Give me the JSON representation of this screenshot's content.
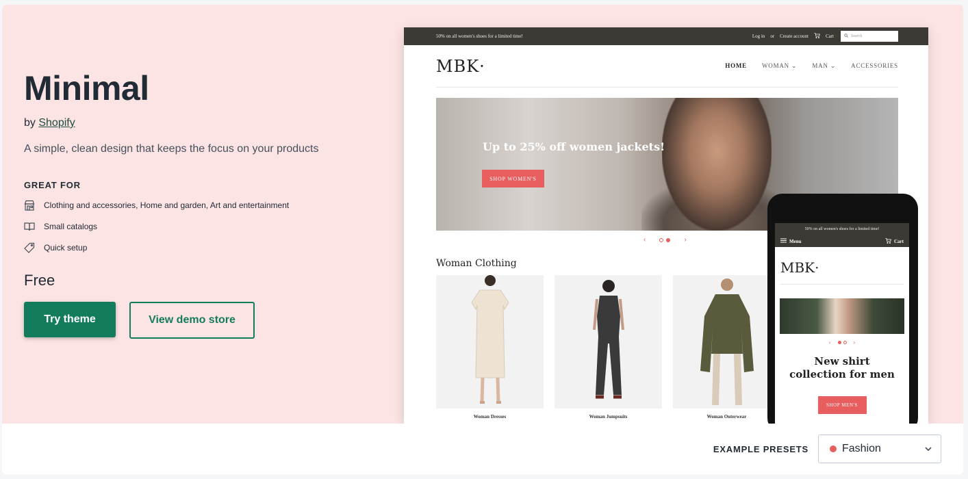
{
  "theme": {
    "title": "Minimal",
    "by_prefix": "by",
    "author": "Shopify",
    "description": "A simple, clean design that keeps the focus on your products",
    "great_for_heading": "GREAT FOR",
    "features": [
      {
        "icon": "store-icon",
        "label": "Clothing and accessories, Home and garden, Art and entertainment"
      },
      {
        "icon": "book-icon",
        "label": "Small catalogs"
      },
      {
        "icon": "tag-icon",
        "label": "Quick setup"
      }
    ],
    "price": "Free",
    "try_label": "Try theme",
    "demo_label": "View demo store"
  },
  "desktop_preview": {
    "announcement": "50% on all women's shoes for a limited time!",
    "login": "Log in",
    "or": "or",
    "create_account": "Create account",
    "cart": "Cart",
    "search_placeholder": "Search",
    "logo": "MBK·",
    "nav": [
      "HOME",
      "WOMAN ⌄",
      "MAN ⌄",
      "ACCESSORIES"
    ],
    "banner_text": "Up to 25% off women jackets!",
    "banner_button": "SHOP WOMEN'S",
    "section_title": "Woman Clothing",
    "products": [
      "Woman Dresses",
      "Woman Jumpsuits",
      "Woman Outerwear"
    ]
  },
  "mobile_preview": {
    "announcement": "50% on all women's shoes for a limited time!",
    "menu": "Menu",
    "cart": "Cart",
    "logo": "MBK·",
    "headline": "New shirt collection for men",
    "button": "SHOP MEN'S"
  },
  "footer": {
    "presets_label": "EXAMPLE PRESETS",
    "preset_value": "Fashion",
    "preset_color": "#e85d5d"
  },
  "colors": {
    "hero_bg": "#fce4e4",
    "primary": "#137c5c",
    "accent": "#e85d5d"
  }
}
